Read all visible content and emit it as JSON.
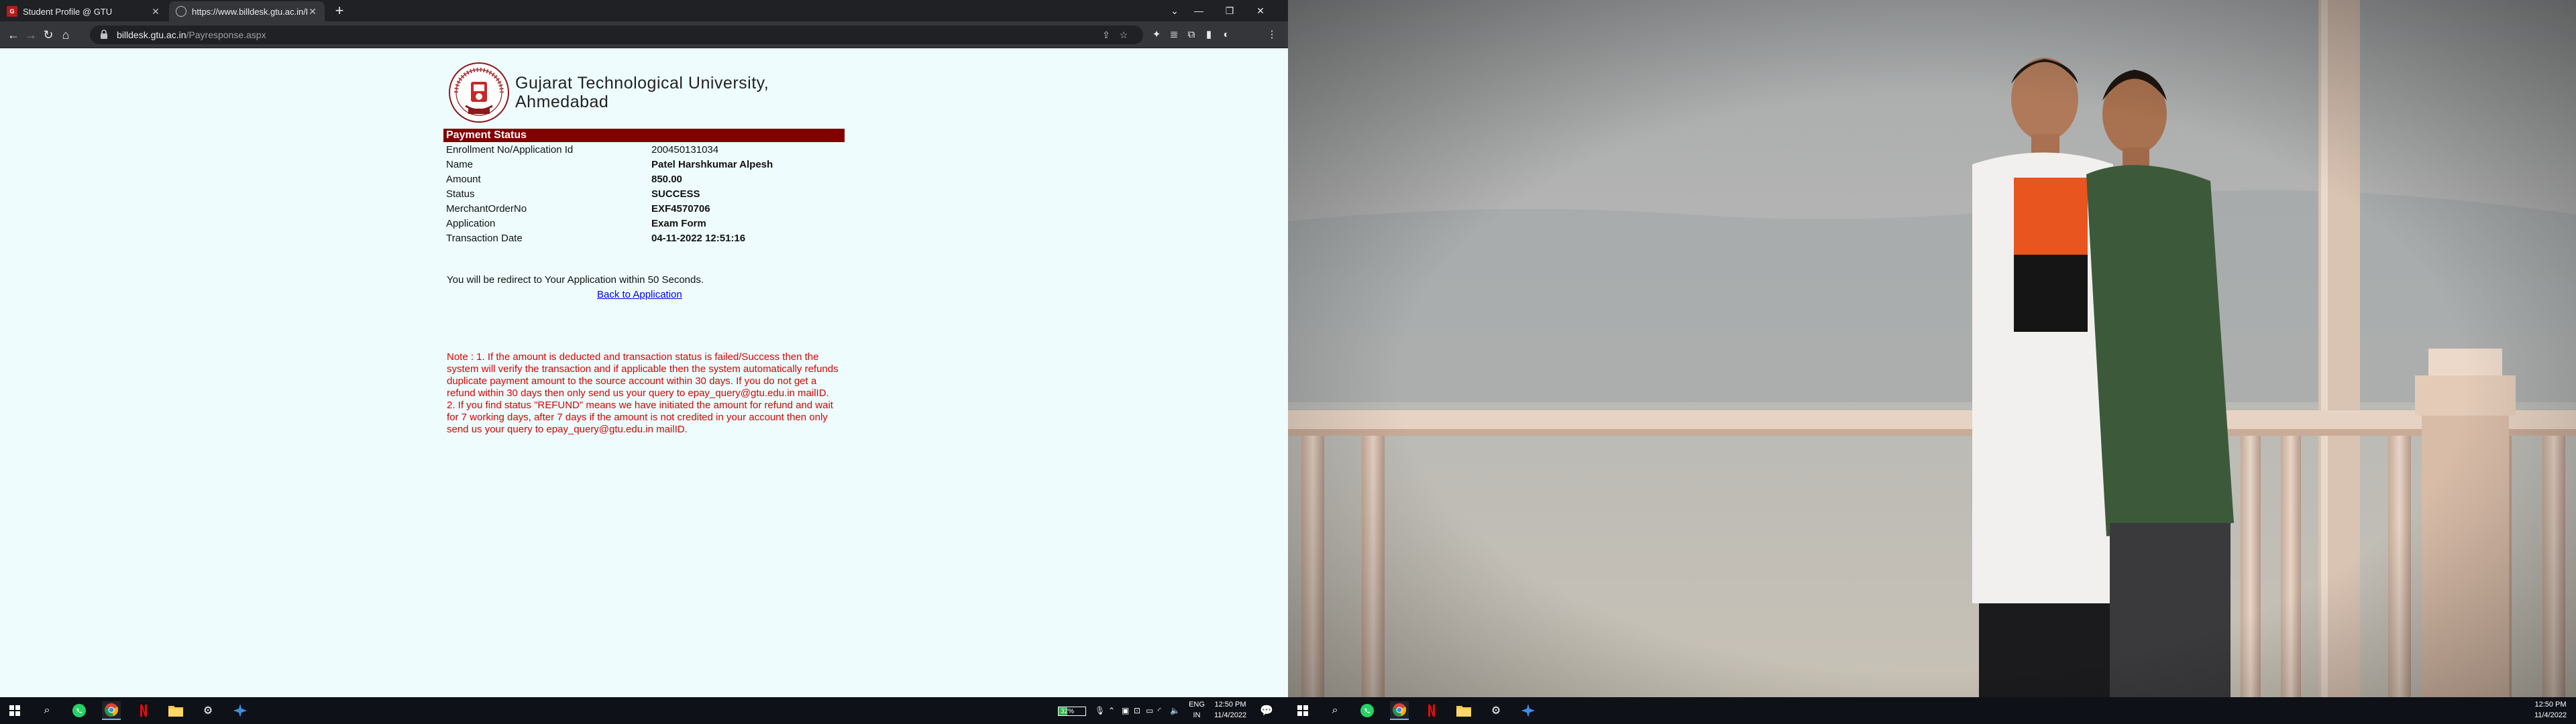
{
  "browser": {
    "tabs": [
      {
        "title": "Student Profile @ GTU",
        "active": false,
        "favicon": "gtu-favicon"
      },
      {
        "title": "https://www.billdesk.gtu.ac.in/Pa",
        "active": true,
        "favicon": "globe-icon"
      }
    ],
    "url": {
      "host": "billdesk.gtu.ac.in",
      "path": "/Payresponse.aspx"
    }
  },
  "page": {
    "university_name_line1": "Gujarat Technological University,",
    "university_name_line2": "Ahmedabad",
    "section_title": "Payment Status",
    "rows": [
      {
        "label": "Enrollment No/Application Id",
        "value": "200450131034",
        "bold": false
      },
      {
        "label": "Name",
        "value": "Patel Harshkumar Alpesh",
        "bold": true
      },
      {
        "label": "Amount",
        "value": "850.00",
        "bold": true
      },
      {
        "label": "Status",
        "value": "SUCCESS",
        "bold": true
      },
      {
        "label": "MerchantOrderNo",
        "value": "EXF4570706",
        "bold": true
      },
      {
        "label": "Application",
        "value": "Exam Form",
        "bold": true
      },
      {
        "label": "Transaction Date",
        "value": "04-11-2022 12:51:16",
        "bold": true
      }
    ],
    "redirect_text": "You will be redirect to Your Application within 50 Seconds.",
    "back_link": "Back to Application",
    "note_line1": "Note : 1. If the amount is deducted and transaction status is failed/Success then the system will verify the transaction and if applicable then the system automatically refunds duplicate payment amount to the source account within 30 days. If you do not get a refund within 30 days then only send us your query to epay_query@gtu.edu.in mailID.",
    "note_line2": "2. If you find status \"REFUND\" means we have initiated the amount for refund and wait for 7 working days, after 7 days if the amount is not credited in your account then only send us your query to epay_query@gtu.edu.in mailID."
  },
  "taskbar_left": {
    "battery_percent": "32%",
    "battery_level": 0.32,
    "language_line1": "ENG",
    "language_line2": "IN",
    "time": "12:50 PM",
    "date": "11/4/2022"
  },
  "taskbar_right": {
    "time": "12:50 PM",
    "date": "11/4/2022"
  },
  "colors": {
    "payment_bar": "#800000",
    "note_text": "#e00000",
    "page_bg": "#eefcfe",
    "link": "#0000ee"
  }
}
